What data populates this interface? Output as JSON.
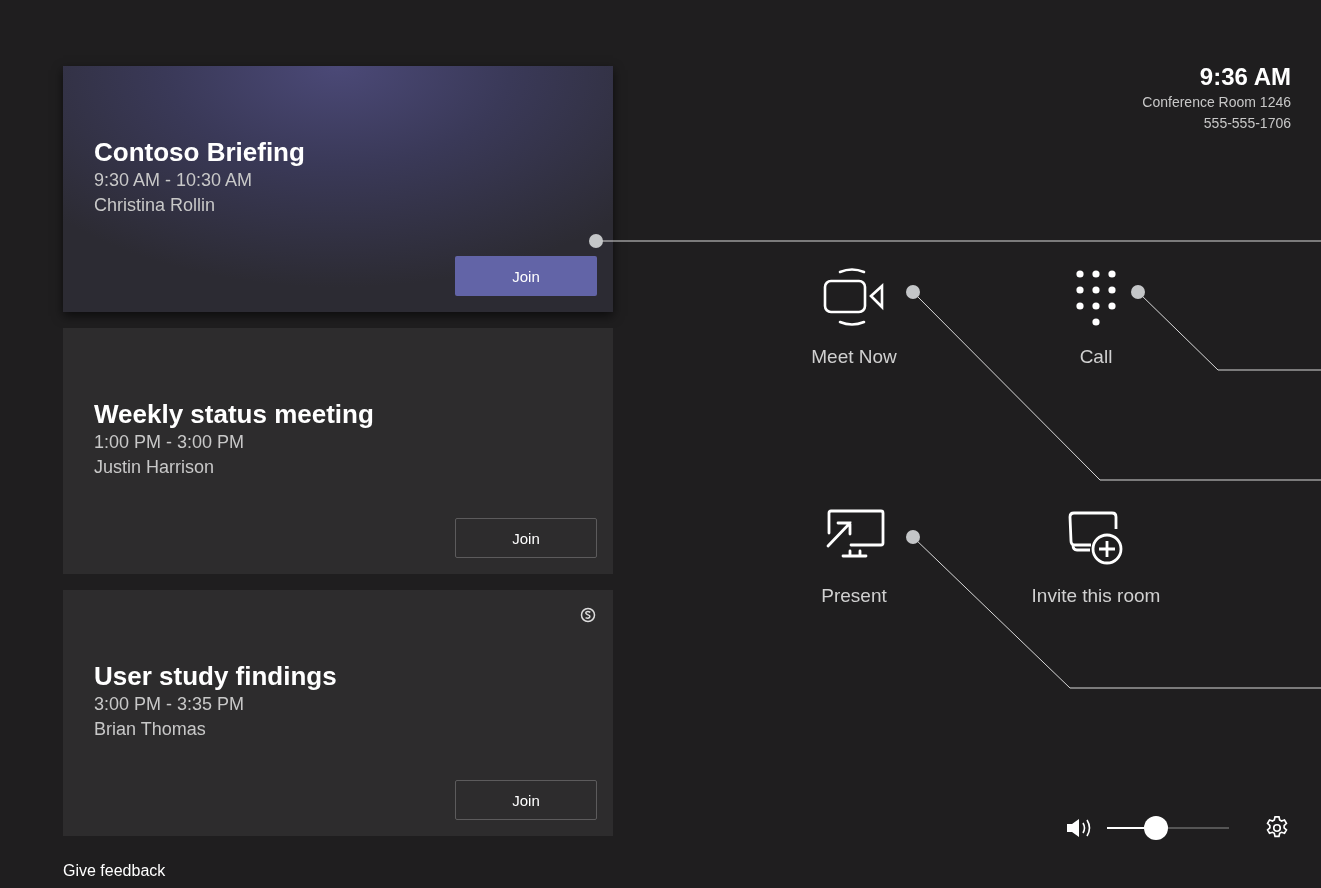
{
  "status": {
    "clock": "9:36 AM",
    "room": "Conference Room 1246",
    "phone": "555-555-1706"
  },
  "meetings": [
    {
      "title": "Contoso Briefing",
      "time": "9:30 AM - 10:30 AM",
      "organizer": "Christina Rollin",
      "selected": true,
      "skype_meeting": false,
      "join": "Join"
    },
    {
      "title": "Weekly status meeting",
      "time": "1:00 PM - 3:00 PM",
      "organizer": "Justin Harrison",
      "selected": false,
      "skype_meeting": false,
      "join": "Join"
    },
    {
      "title": "User study findings",
      "time": "3:00 PM - 3:35 PM",
      "organizer": "Brian Thomas",
      "selected": false,
      "skype_meeting": true,
      "join": "Join"
    }
  ],
  "actions": [
    {
      "kind": "meet",
      "label": "Meet Now"
    },
    {
      "kind": "call",
      "label": "Call"
    },
    {
      "kind": "present",
      "label": "Present"
    },
    {
      "kind": "invite",
      "label": "Invite this room"
    }
  ],
  "volume": {
    "level": 0.4
  },
  "feedback": "Give feedback"
}
